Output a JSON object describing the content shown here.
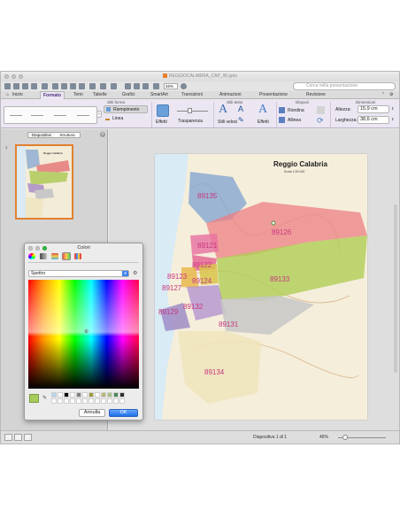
{
  "window": {
    "title": "REGGIOCALABRIA_CAP_90.pptx",
    "zoom": "46%",
    "search_placeholder": "Cerca nella presentazione"
  },
  "tabs": [
    "Inizio",
    "Formato",
    "Temi",
    "Tabelle",
    "Grafici",
    "SmartArt",
    "Transizioni",
    "Animazioni",
    "Presentazione",
    "Revisione"
  ],
  "active_tab": "Formato",
  "ribbon": {
    "group_shape_styles": "Stili forma",
    "group_text_styles": "Stili testo",
    "group_arrange": "Disponi",
    "group_size": "Dimensioni",
    "fill_label": "Riempimento",
    "line_label": "Linea",
    "effects_label": "Effetti",
    "transparency_label": "Trasparenza",
    "quick_styles_label": "Stili veloci",
    "text_effects_label": "Effetti",
    "order_label": "Riordina",
    "align_label": "Allinea",
    "height_label": "Altezza:",
    "height_value": "15,9 cm",
    "width_label": "Larghezza:",
    "width_value": "38,6 cm"
  },
  "left_pane": {
    "tab_slides": "Diapositive",
    "tab_outline": "Struttura",
    "slide_number": "1"
  },
  "slide": {
    "map_title": "Reggio Calabria",
    "map_scale": "Scala 1:50.000",
    "zones": [
      "89135",
      "89126",
      "89121",
      "89122",
      "89123",
      "89124",
      "89127",
      "89133",
      "89132",
      "89129",
      "89131",
      "89134"
    ]
  },
  "statusbar": {
    "slide_info": "Diapositiva 1 di 1",
    "zoom": "46%"
  },
  "colors_panel": {
    "title": "Colori",
    "palette_select": "Spettro",
    "cancel_label": "Annulla",
    "ok_label": "OK",
    "current_color": "#a6cc5a"
  },
  "accent_colors": {
    "brand": "#4b2f7c",
    "ok_button": "#1f6fe6",
    "slide_selection": "#e0812f",
    "zone_label": "#c8367f"
  }
}
